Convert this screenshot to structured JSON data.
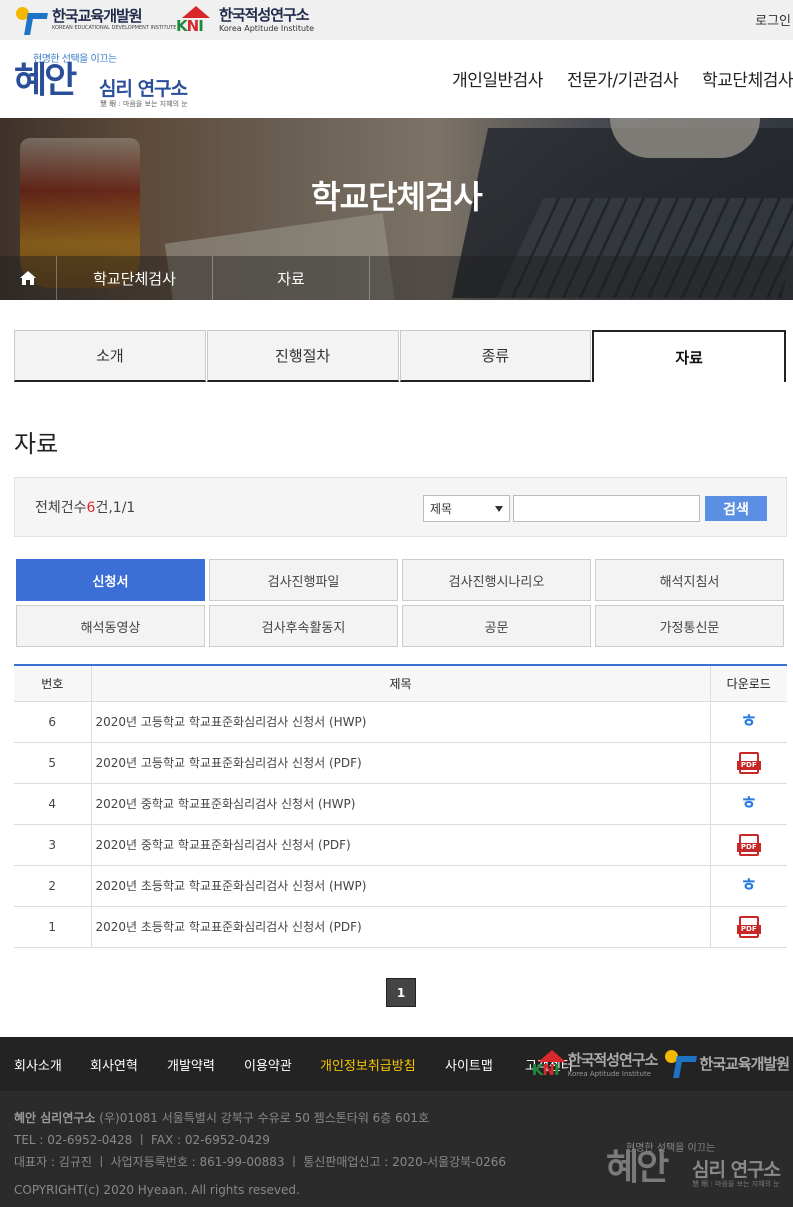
{
  "topbar": {
    "org1_name": "한국교육개발원",
    "org1_en": "KOREAN EDUCATIONAL DEVELOPMENT INSTITUTE",
    "org2_mark": "KNI",
    "org2_name": "한국적성연구소",
    "org2_en": "Korea Aptitude Institute",
    "login": "로그인"
  },
  "header": {
    "logo_slogan": "현명한 선택을 이끄는",
    "logo_big": "혜안",
    "logo_name": "심리 연구소",
    "logo_sub": "慧 眼 : 마음을 보는 지혜의 눈",
    "nav": [
      "개인일반검사",
      "전문가/기관검사",
      "학교단체검사"
    ]
  },
  "hero": {
    "title": "학교단체검사",
    "breadcrumb": [
      "학교단체검사",
      "자료"
    ]
  },
  "tabs": [
    {
      "label": "소개",
      "active": false
    },
    {
      "label": "진행절차",
      "active": false
    },
    {
      "label": "종류",
      "active": false
    },
    {
      "label": "자료",
      "active": true
    }
  ],
  "section_title": "자료",
  "search": {
    "count_prefix": "전체건수",
    "count_value": "6",
    "count_suffix": "건,1/1",
    "select_value": "제목",
    "input_value": "",
    "button": "검색"
  },
  "categories": [
    {
      "label": "신청서",
      "active": true
    },
    {
      "label": "검사진행파일",
      "active": false
    },
    {
      "label": "검사진행시나리오",
      "active": false
    },
    {
      "label": "해석지침서",
      "active": false
    },
    {
      "label": "해석동영상",
      "active": false
    },
    {
      "label": "검사후속활동지",
      "active": false
    },
    {
      "label": "공문",
      "active": false
    },
    {
      "label": "가정통신문",
      "active": false
    }
  ],
  "table": {
    "headers": [
      "번호",
      "제목",
      "다운로드"
    ],
    "rows": [
      {
        "num": "6",
        "title": "2020년 고등학교 학교표준화심리검사 신청서 (HWP)",
        "file": "hwp-icon"
      },
      {
        "num": "5",
        "title": "2020년 고등학교 학교표준화심리검사 신청서 (PDF)",
        "file": "pdf-icon"
      },
      {
        "num": "4",
        "title": "2020년 중학교 학교표준화심리검사 신청서 (HWP)",
        "file": "hwp-icon"
      },
      {
        "num": "3",
        "title": "2020년 중학교 학교표준화심리검사 신청서 (PDF)",
        "file": "pdf-icon"
      },
      {
        "num": "2",
        "title": "2020년 초등학교 학교표준화심리검사 신청서 (HWP)",
        "file": "hwp-icon"
      },
      {
        "num": "1",
        "title": "2020년 초등학교 학교표준화심리검사 신청서 (PDF)",
        "file": "pdf-icon"
      }
    ],
    "hwp_glyph": "ㅎ",
    "pdf_glyph": "PDF"
  },
  "pagination": {
    "current": "1"
  },
  "footer": {
    "nav": [
      "회사소개",
      "회사연혁",
      "개발약력",
      "이용약관",
      "개인정보취급방침",
      "사이트맵",
      "고객센터"
    ],
    "org_kni": "한국적성연구소",
    "org_kni_en": "Korea Aptitude Institute",
    "org_kedi": "한국교육개발원",
    "company": "혜안 심리연구소",
    "address": "(우)01081 서울특별시 강북구 수유로 50 젬스톤타워 6층 601호",
    "tel_fax": "TEL : 02-6952-0428 ㅣ FAX : 02-6952-0429",
    "ceo_biz": "대표자 : 김규진 ㅣ 사업자등록번호 : 861-99-00883 ㅣ 통신판매업신고 : 2020-서울강북-0266",
    "copyright": "COPYRIGHT(c) 2020 Hyeaan. All rights reseved.",
    "logo_slogan": "현명한 선택을 이끄는",
    "logo_big": "혜안",
    "logo_name": "심리 연구소",
    "logo_sub": "慧 眼 : 마음을 보는 지혜의 눈"
  },
  "colors": {
    "accent": "#3b6fd6",
    "highlight": "#f5c400",
    "count_red": "#e02a2a"
  }
}
